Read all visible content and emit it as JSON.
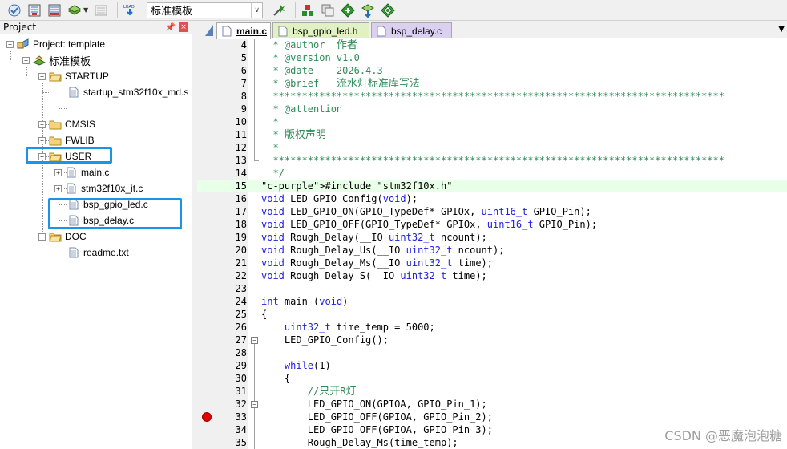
{
  "toolbar": {
    "target_name": "标准模板"
  },
  "project_pane": {
    "title": "Project",
    "pin": "ᵖ",
    "close": "×",
    "tree": [
      {
        "label": "Project: template",
        "kind": "project",
        "depth": 0
      },
      {
        "label": "标准模板",
        "kind": "target",
        "depth": 1
      },
      {
        "label": "STARTUP",
        "kind": "folder",
        "depth": 2
      },
      {
        "label": "startup_stm32f10x_md.s",
        "kind": "file",
        "depth": 3
      },
      {
        "label": "CMSIS",
        "kind": "folder",
        "depth": 2
      },
      {
        "label": "FWLIB",
        "kind": "folder",
        "depth": 2
      },
      {
        "label": "USER",
        "kind": "folder",
        "depth": 2
      },
      {
        "label": "main.c",
        "kind": "file",
        "depth": 3
      },
      {
        "label": "stm32f10x_it.c",
        "kind": "file",
        "depth": 3
      },
      {
        "label": "bsp_gpio_led.c",
        "kind": "file",
        "depth": 3
      },
      {
        "label": "bsp_delay.c",
        "kind": "file",
        "depth": 3
      },
      {
        "label": "DOC",
        "kind": "folder",
        "depth": 2
      },
      {
        "label": "readme.txt",
        "kind": "file",
        "depth": 3
      }
    ]
  },
  "tabs": [
    {
      "label": "main.c",
      "active": true,
      "color": "#ffffff"
    },
    {
      "label": "bsp_gpio_led.h",
      "active": false,
      "color": "#e1f1c4"
    },
    {
      "label": "bsp_delay.c",
      "active": false,
      "color": "#dcd0f0"
    }
  ],
  "code_lines": [
    {
      "n": "4",
      "text": "  * @author  作者"
    },
    {
      "n": "5",
      "text": "  * @version v1.0"
    },
    {
      "n": "6",
      "text": "  * @date    2026.4.3"
    },
    {
      "n": "7",
      "text": "  * @brief   流水灯标准库写法"
    },
    {
      "n": "8",
      "text": "  ******************************************************************************"
    },
    {
      "n": "9",
      "text": "  * @attention"
    },
    {
      "n": "10",
      "text": "  *"
    },
    {
      "n": "11",
      "text": "  * 版权声明"
    },
    {
      "n": "12",
      "text": "  *"
    },
    {
      "n": "13",
      "text": "  ******************************************************************************"
    },
    {
      "n": "14",
      "text": "  */"
    },
    {
      "n": "15",
      "text": "#include \"stm32f10x.h\""
    },
    {
      "n": "16",
      "text": "void LED_GPIO_Config(void);"
    },
    {
      "n": "17",
      "text": "void LED_GPIO_ON(GPIO_TypeDef* GPIOx, uint16_t GPIO_Pin);"
    },
    {
      "n": "18",
      "text": "void LED_GPIO_OFF(GPIO_TypeDef* GPIOx, uint16_t GPIO_Pin);"
    },
    {
      "n": "19",
      "text": "void Rough_Delay(__IO uint32_t ncount);"
    },
    {
      "n": "20",
      "text": "void Rough_Delay_Us(__IO uint32_t ncount);"
    },
    {
      "n": "21",
      "text": "void Rough_Delay_Ms(__IO uint32_t time);"
    },
    {
      "n": "22",
      "text": "void Rough_Delay_S(__IO uint32_t time);"
    },
    {
      "n": "23",
      "text": ""
    },
    {
      "n": "24",
      "text": "int main (void)"
    },
    {
      "n": "25",
      "text": "{"
    },
    {
      "n": "26",
      "text": "    uint32_t time_temp = 5000;"
    },
    {
      "n": "27",
      "text": "    LED_GPIO_Config();"
    },
    {
      "n": "28",
      "text": ""
    },
    {
      "n": "29",
      "text": "    while(1)"
    },
    {
      "n": "30",
      "text": "    {"
    },
    {
      "n": "31",
      "text": "        //只开R灯"
    },
    {
      "n": "32",
      "text": "        LED_GPIO_ON(GPIOA, GPIO_Pin_1);"
    },
    {
      "n": "33",
      "text": "        LED_GPIO_OFF(GPIOA, GPIO_Pin_2);"
    },
    {
      "n": "34",
      "text": "        LED_GPIO_OFF(GPIOA, GPIO_Pin_3);"
    },
    {
      "n": "35",
      "text": "        Rough_Delay_Ms(time_temp);"
    }
  ],
  "watermark": "CSDN @恶魔泡泡糖",
  "colors": {
    "highlight_box": "#1a94e8",
    "breakpoint": "#e00000",
    "comment": "#2e8b57",
    "keyword": "#2020e0"
  }
}
